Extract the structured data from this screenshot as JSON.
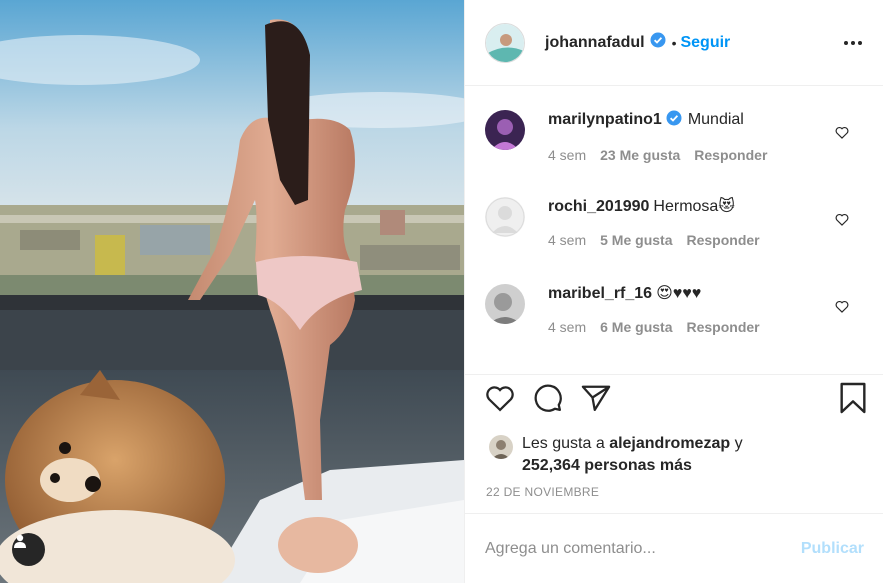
{
  "post": {
    "author": "johannafadul",
    "follow_label": "Seguir",
    "separator": "•",
    "date": "22 DE NOVIEMBRE"
  },
  "comments": [
    {
      "user": "marilynpatino1",
      "verified": true,
      "text": "Mundial",
      "age": "4 sem",
      "likes": "23 Me gusta",
      "reply": "Responder"
    },
    {
      "user": "rochi_201990",
      "verified": false,
      "text": "Hermosa😻",
      "age": "4 sem",
      "likes": "5 Me gusta",
      "reply": "Responder"
    },
    {
      "user": "maribel_rf_16",
      "verified": false,
      "text": "😍♥♥♥",
      "age": "4 sem",
      "likes": "6 Me gusta",
      "reply": "Responder"
    }
  ],
  "likes_line": {
    "prefix": "Les gusta a",
    "user": "alejandromezap",
    "conj": "y",
    "count": "252,364 personas más"
  },
  "comment_box": {
    "placeholder": "Agrega un comentario...",
    "publish_label": "Publicar"
  },
  "colors": {
    "accent": "#0095f6",
    "publish_disabled": "#b2dffc",
    "muted": "#8e8e8e",
    "text": "#262626"
  },
  "icons": [
    "user-tag-icon",
    "verified-badge-icon",
    "more-options-icon",
    "heart-icon",
    "comment-icon",
    "share-icon",
    "bookmark-icon"
  ]
}
